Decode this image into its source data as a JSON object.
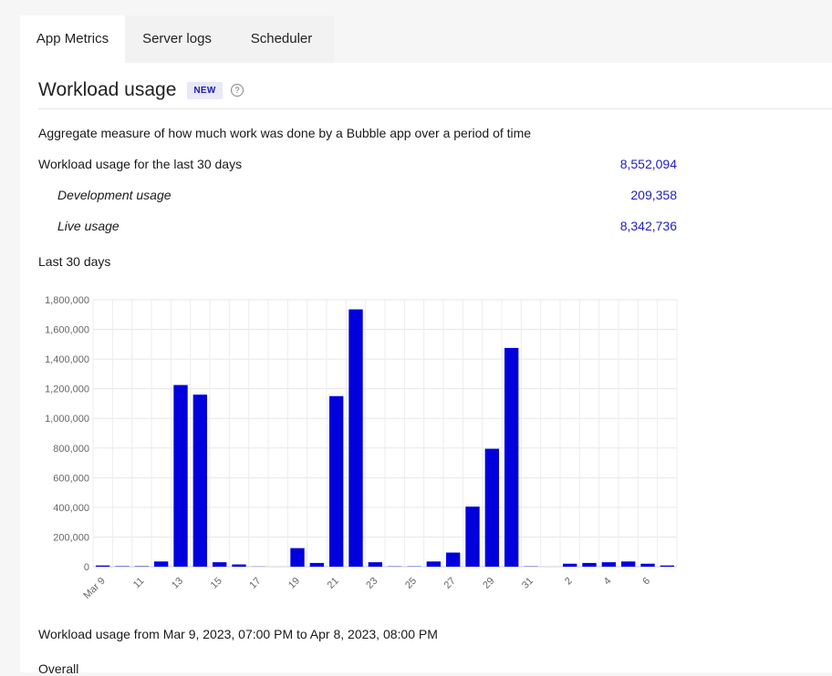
{
  "tabs": [
    "App Metrics",
    "Server logs",
    "Scheduler"
  ],
  "section": {
    "title": "Workload usage",
    "badge": "NEW",
    "help_icon": "question-circle-icon"
  },
  "description": "Aggregate measure of how much work was done by a Bubble app over a period of time",
  "summary": {
    "total_label": "Workload usage for the last 30 days",
    "total_value": "8,552,094",
    "dev_label": "Development usage",
    "dev_value": "209,358",
    "live_label": "Live usage",
    "live_value": "8,342,736"
  },
  "chart_heading": "Last 30 days",
  "range_text": "Workload usage from Mar 9, 2023, 07:00 PM to Apr 8, 2023, 08:00 PM",
  "overall_label": "Overall",
  "colors": {
    "bar": "#0000dd",
    "link": "#2020c0"
  },
  "chart_data": {
    "type": "bar",
    "categories": [
      "Mar 9",
      "10",
      "11",
      "12",
      "13",
      "14",
      "15",
      "16",
      "17",
      "18",
      "19",
      "20",
      "21",
      "22",
      "23",
      "24",
      "25",
      "26",
      "27",
      "28",
      "29",
      "30",
      "31",
      "1",
      "2",
      "3",
      "4",
      "5",
      "6",
      "7"
    ],
    "tick_labels": [
      "Mar 9",
      "11",
      "13",
      "15",
      "17",
      "19",
      "21",
      "23",
      "25",
      "27",
      "29",
      "31",
      "2",
      "4",
      "6"
    ],
    "values": [
      8000,
      3000,
      3000,
      35000,
      1225000,
      1160000,
      30000,
      15000,
      1000,
      0,
      125000,
      25000,
      1150000,
      1735000,
      30000,
      2000,
      2000,
      35000,
      95000,
      405000,
      795000,
      1475000,
      2000,
      0,
      20000,
      25000,
      30000,
      35000,
      20000,
      8000
    ],
    "y_ticks": [
      0,
      200000,
      400000,
      600000,
      800000,
      1000000,
      1200000,
      1400000,
      1600000,
      1800000
    ],
    "y_tick_labels": [
      "0",
      "200,000",
      "400,000",
      "600,000",
      "800,000",
      "1,000,000",
      "1,200,000",
      "1,400,000",
      "1,600,000",
      "1,800,000"
    ],
    "ylim": [
      0,
      1800000
    ],
    "grid": true,
    "legend": "none"
  }
}
